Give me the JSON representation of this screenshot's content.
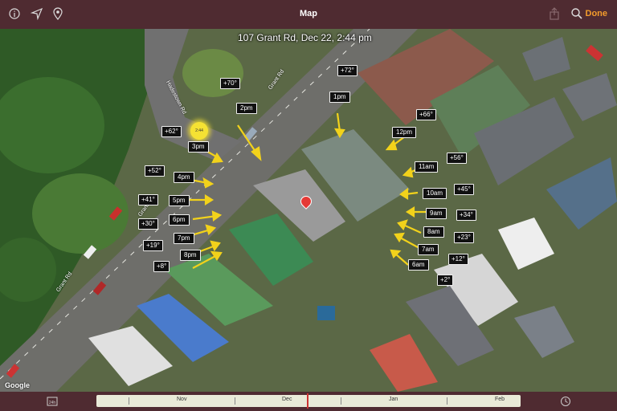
{
  "header": {
    "title": "Map",
    "done_label": "Done",
    "icons": [
      "info-icon",
      "location-arrow-icon",
      "pin-icon",
      "share-icon",
      "search-icon"
    ]
  },
  "map": {
    "address": "107 Grant Rd, Dec 22, 2:44 pm",
    "roads": [
      "Grant Rd",
      "Hadestown Rd",
      "Grant Rd",
      "Grant Rd"
    ],
    "attribution": "Google",
    "sun_label": "2:44",
    "sun_angles": [
      "+72°",
      "+70°",
      "+66°",
      "+62°",
      "+56°",
      "+52°",
      "+45°",
      "+41°",
      "+34°",
      "+30°",
      "+23°",
      "+19°",
      "+12°",
      "+8°",
      "+2°"
    ],
    "hours": [
      "1pm",
      "2pm",
      "12pm",
      "3pm",
      "11am",
      "4pm",
      "10am",
      "5pm",
      "9am",
      "6pm",
      "8am",
      "7pm",
      "7am",
      "8pm",
      "6am"
    ]
  },
  "timeline": {
    "months": [
      "Nov",
      "Dec",
      "Jan",
      "Feb"
    ],
    "left_icon": "24h-icon",
    "right_icon": "clock-icon"
  },
  "colors": {
    "accent": "#f39c2c",
    "bar": "#4f2b31",
    "pin": "#e53935"
  }
}
